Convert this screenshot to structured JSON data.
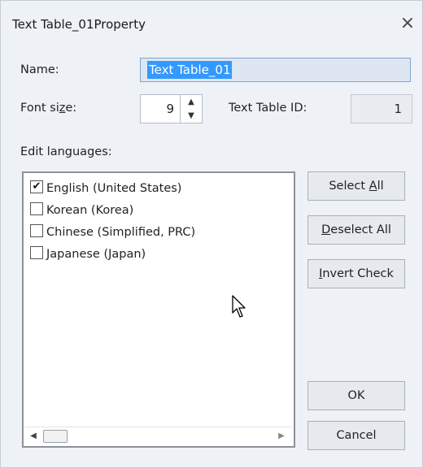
{
  "window": {
    "title": "Text Table_01Property",
    "close_glyph": "×"
  },
  "fields": {
    "name_label": "Name:",
    "name_value": "Text Table_01",
    "font_size_label_pre": "Font si",
    "font_size_label_mnemonic": "z",
    "font_size_label_post": "e:",
    "font_size_value": "9",
    "text_table_id_label": "Text Table ID:",
    "text_table_id_value": "1"
  },
  "languages": {
    "label": "Edit languages:",
    "items": [
      {
        "label": "English (United States)",
        "checked": true
      },
      {
        "label": "Korean (Korea)",
        "checked": false
      },
      {
        "label": "Chinese (Simplified, PRC)",
        "checked": false
      },
      {
        "label": "Japanese (Japan)",
        "checked": false
      }
    ]
  },
  "buttons": {
    "select_all_pre": "Select ",
    "select_all_mnemonic": "A",
    "select_all_post": "ll",
    "deselect_all_mnemonic": "D",
    "deselect_all_post": "eselect All",
    "invert_check_mnemonic": "I",
    "invert_check_post": "nvert Check",
    "ok": "OK",
    "cancel": "Cancel"
  },
  "icons": {
    "close": "close-icon",
    "spin_up": "chevron-up-icon",
    "spin_down": "chevron-down-icon",
    "scroll_left": "arrow-left-icon",
    "scroll_right": "arrow-right-icon",
    "pointer": "mouse-pointer-icon"
  },
  "colors": {
    "dialog_bg": "#eef1f6",
    "selection": "#3399ff",
    "button_bg": "#e6e9ee"
  }
}
